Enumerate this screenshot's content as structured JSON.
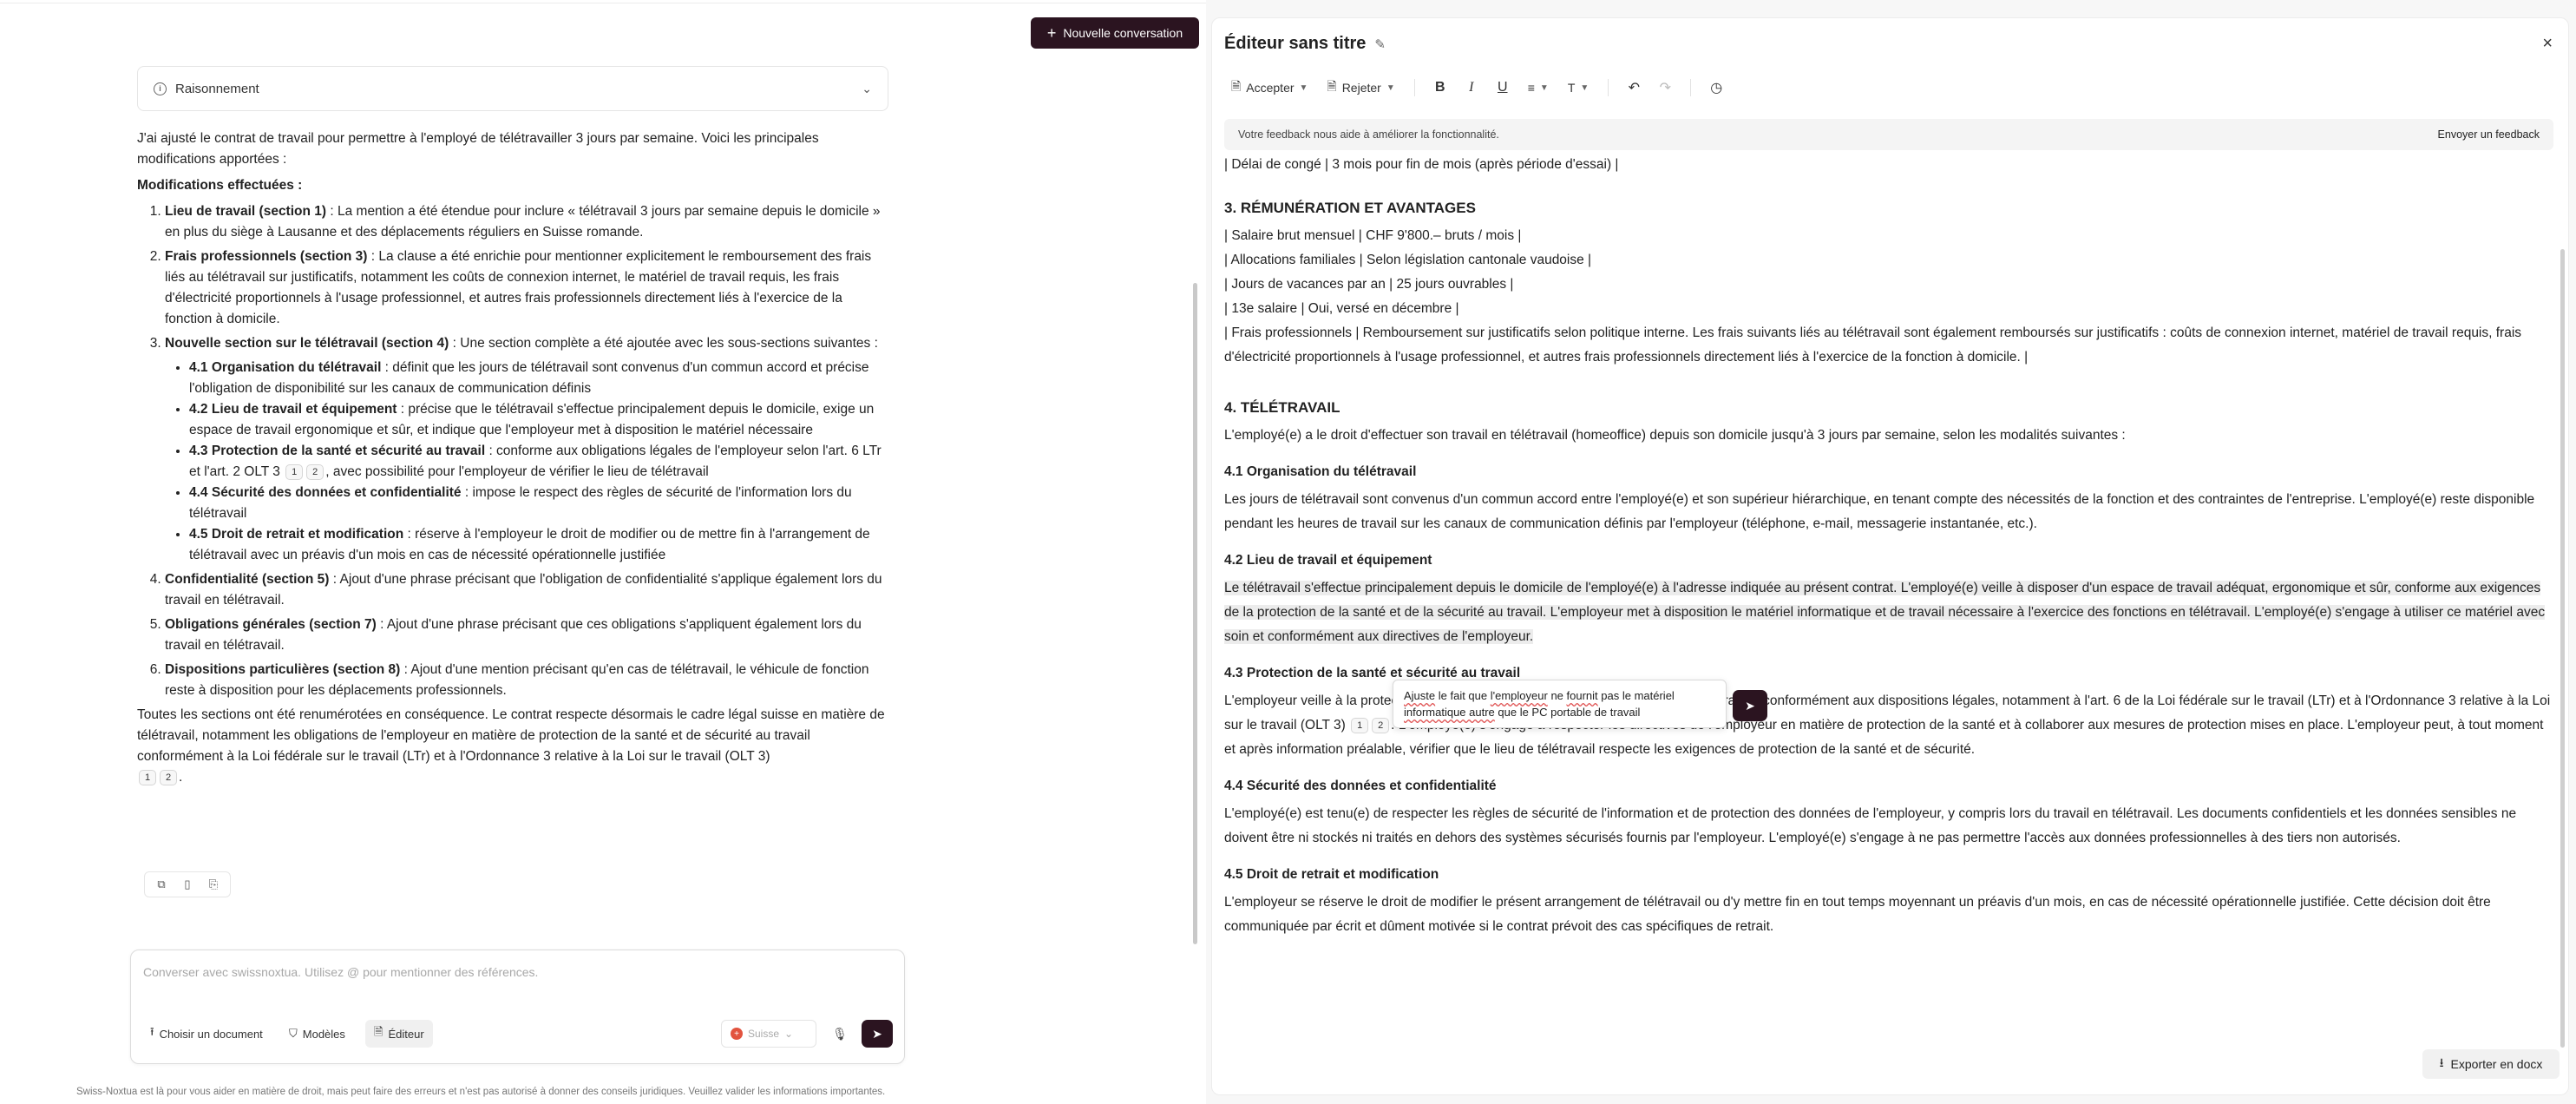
{
  "header": {
    "new_conversation": "Nouvelle conversation"
  },
  "reasoning": {
    "label": "Raisonnement"
  },
  "answer": {
    "intro": "J'ai ajusté le contrat de travail pour permettre à l'employé de télétravailler 3 jours par semaine. Voici les principales modifications apportées :",
    "mods_title": "Modifications effectuées :",
    "items": [
      {
        "title": "Lieu de travail (section 1)",
        "text": " : La mention a été étendue pour inclure « télétravail 3 jours par semaine depuis le domicile » en plus du siège à Lausanne et des déplacements réguliers en Suisse romande."
      },
      {
        "title": "Frais professionnels (section 3)",
        "text": " : La clause a été enrichie pour mentionner explicitement le remboursement des frais liés au télétravail sur justificatifs, notamment les coûts de connexion internet, le matériel de travail requis, les frais d'électricité proportionnels à l'usage professionnel, et autres frais professionnels directement liés à l'exercice de la fonction à domicile."
      },
      {
        "title": "Nouvelle section sur le télétravail (section 4)",
        "text": " : Une section complète a été ajoutée avec les sous-sections suivantes :"
      },
      {
        "title": "Confidentialité (section 5)",
        "text": " : Ajout d'une phrase précisant que l'obligation de confidentialité s'applique également lors du travail en télétravail."
      },
      {
        "title": "Obligations générales (section 7)",
        "text": " : Ajout d'une phrase précisant que ces obligations s'appliquent également lors du travail en télétravail."
      },
      {
        "title": "Dispositions particulières (section 8)",
        "text": " : Ajout d'une mention précisant qu'en cas de télétravail, le véhicule de fonction reste à disposition pour les déplacements professionnels."
      }
    ],
    "sub": [
      {
        "title": "4.1 Organisation du télétravail",
        "text": " : définit que les jours de télétravail sont convenus d'un commun accord et précise l'obligation de disponibilité sur les canaux de communication définis"
      },
      {
        "title": "4.2 Lieu de travail et équipement",
        "text": " : précise que le télétravail s'effectue principalement depuis le domicile, exige un espace de travail ergonomique et sûr, et indique que l'employeur met à disposition le matériel nécessaire"
      },
      {
        "title": "4.3 Protection de la santé et sécurité au travail",
        "text": " : conforme aux obligations légales de l'employeur selon l'art. 6 LTr et l'art. 2 OLT 3",
        "text2": ", avec possibilité pour l'employeur de vérifier le lieu de télétravail"
      },
      {
        "title": "4.4 Sécurité des données et confidentialité",
        "text": " : impose le respect des règles de sécurité de l'information lors du télétravail"
      },
      {
        "title": "4.5 Droit de retrait et modification",
        "text": " : réserve à l'employeur le droit de modifier ou de mettre fin à l'arrangement de télétravail avec un préavis d'un mois en cas de nécessité opérationnelle justifiée"
      }
    ],
    "conclusion": "Toutes les sections ont été renumérotées en conséquence. Le contrat respecte désormais le cadre légal suisse en matière de télétravail, notamment les obligations de l'employeur en matière de protection de la santé et de sécurité au travail conformément à la Loi fédérale sur le travail (LTr) et à l'Ordonnance 3 relative à la Loi sur le travail (OLT 3)",
    "cite1": "1",
    "cite2": "2",
    "period": "."
  },
  "composer": {
    "placeholder": "Converser avec swissnoxtua. Utilisez @ pour mentionner des références.",
    "choose_doc": "Choisir un document",
    "models": "Modèles",
    "editor": "Éditeur",
    "country": "Suisse"
  },
  "disclaimer": "Swiss-Noxtua est là pour vous aider en matière de droit, mais peut faire des erreurs et n'est pas autorisé à donner des conseils juridiques. Veuillez valider les informations importantes.",
  "editor": {
    "title": "Éditeur sans titre",
    "toolbar": {
      "accept": "Accepter",
      "reject": "Rejeter"
    },
    "feedback": {
      "text": "Votre feedback nous aide à améliorer la fonctionnalité.",
      "button": "Envoyer un feedback"
    },
    "doc": {
      "cut_line": "| Délai de congé | 3 mois pour fin de mois (après période d'essai) |",
      "s3_title": "3. RÉMUNÉRATION ET AVANTAGES",
      "s3_lines": [
        "| Salaire brut mensuel | CHF 9'800.– bruts / mois |",
        "| Allocations familiales | Selon législation cantonale vaudoise |",
        "| Jours de vacances par an | 25 jours ouvrables |",
        "| 13e salaire | Oui, versé en décembre |",
        "| Frais professionnels | Remboursement sur justificatifs selon politique interne. Les frais suivants liés au télétravail sont également remboursés sur justificatifs : coûts de connexion internet, matériel de travail requis, frais d'électricité proportionnels à l'usage professionnel, et autres frais professionnels directement liés à l'exercice de la fonction à domicile. |"
      ],
      "s4_title": "4. TÉLÉTRAVAIL",
      "s4_intro": "L'employé(e) a le droit d'effectuer son travail en télétravail (homeoffice) depuis son domicile jusqu'à 3 jours par semaine, selon les modalités suivantes :",
      "s41_title": "4.1 Organisation du télétravail",
      "s41_text": "Les jours de télétravail sont convenus d'un commun accord entre l'employé(e) et son supérieur hiérarchique, en tenant compte des nécessités de la fonction et des contraintes de l'entreprise. L'employé(e) reste disponible pendant les heures de travail sur les canaux de communication définis par l'employeur (téléphone, e-mail, messagerie instantanée, etc.).",
      "s42_title": "4.2 Lieu de travail et équipement",
      "s42_text": "Le télétravail s'effectue principalement depuis le domicile de l'employé(e) à l'adresse indiquée au présent contrat. L'employé(e) veille à disposer d'un espace de travail adéquat, ergonomique et sûr, conforme aux exigences de la protection de la santé et de la sécurité au travail. L'employeur met à disposition le matériel informatique et de travail nécessaire à l'exercice des fonctions en télétravail. L'employé(e) s'engage à utiliser ce matériel avec soin et conformément aux directives de l'employeur.",
      "s43_title": "4.3 Protection de la santé et sécurité au travail",
      "s43_text_a": "L'employeur veille à la protection de la santé et à la sécurité de l'employé(e) en télétravail, conformément aux dispositions légales, notamment à l'art. 6 de la Loi fédérale sur le travail (LTr) et à l'Ordonnance 3 relative à la Loi sur le travail (OLT 3)",
      "s43_text_b": ". L'employé(e) s'engage à respecter les directives de l'employeur en matière de protection de la santé et à collaborer aux mesures de protection mises en place. L'employeur peut, à tout moment et après information préalable, vérifier que le lieu de télétravail respecte les exigences de protection de la santé et de sécurité.",
      "s44_title": "4.4 Sécurité des données et confidentialité",
      "s44_text": "L'employé(e) est tenu(e) de respecter les règles de sécurité de l'information et de protection des données de l'employeur, y compris lors du travail en télétravail. Les documents confidentiels et les données sensibles ne doivent être ni stockés ni traités en dehors des systèmes sécurisés fournis par l'employeur. L'employé(e) s'engage à ne pas permettre l'accès aux données professionnelles à des tiers non autorisés.",
      "s45_title": "4.5 Droit de retrait et modification",
      "s45_text": "L'employeur se réserve le droit de modifier le présent arrangement de télétravail ou d'y mettre fin en tout temps moyennant un préavis d'un mois, en cas de nécessité opérationnelle justifiée. Cette décision doit être communiquée par écrit et dûment motivée si le contrat prévoit des cas spécifiques de retrait."
    },
    "ai_prompt": {
      "part1": "Ajuste",
      "part2": " le fait que ",
      "part3": "l'employeur",
      "part4": " ne ",
      "part5": "fournit",
      "part6": " pas le matériel ",
      "part7": "informatique autre",
      "part8": " que le PC portable de travail"
    },
    "export": "Exporter en docx"
  }
}
